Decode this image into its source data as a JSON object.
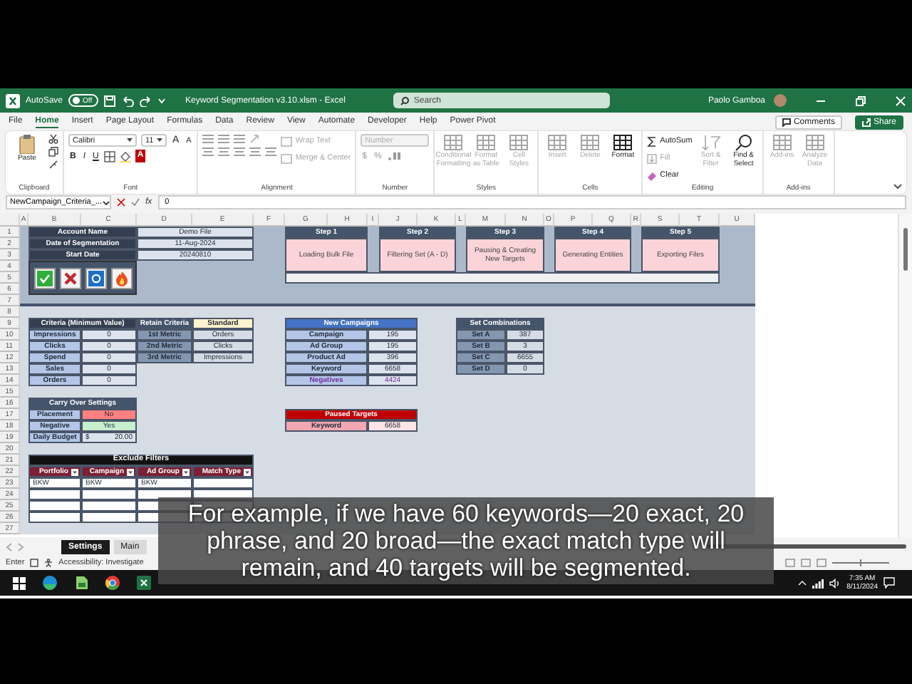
{
  "window": {
    "autosave_label": "AutoSave",
    "autosave_on": false,
    "autosave_state": "Off",
    "title": "Keyword Segmentation v3.10.xlsm - Excel",
    "search_placeholder": "Search",
    "user": "Paolo Gamboa"
  },
  "menu": [
    {
      "label": "File",
      "selected": false
    },
    {
      "label": "Home",
      "selected": true
    },
    {
      "label": "Insert",
      "selected": false
    },
    {
      "label": "Page Layout",
      "selected": false
    },
    {
      "label": "Formulas",
      "selected": false
    },
    {
      "label": "Data",
      "selected": false
    },
    {
      "label": "Review",
      "selected": false
    },
    {
      "label": "View",
      "selected": false
    },
    {
      "label": "Automate",
      "selected": false
    },
    {
      "label": "Developer",
      "selected": false
    },
    {
      "label": "Help",
      "selected": false
    },
    {
      "label": "Power Pivot",
      "selected": false
    }
  ],
  "header_buttons": [
    {
      "label": "Comments",
      "kind": "outline"
    },
    {
      "label": "Share",
      "kind": "primary"
    }
  ],
  "ribbon": [
    {
      "kind": "clipboard",
      "label": "Clipboard",
      "button": "Paste"
    },
    {
      "kind": "font",
      "label": "Font",
      "family": "Calibri",
      "size": "11",
      "size_buttons": [
        "A",
        "A"
      ],
      "style_buttons": [
        "B",
        "I",
        "U"
      ],
      "color_button": "A"
    },
    {
      "kind": "alignment",
      "label": "Alignment",
      "buttons": [
        {
          "label": "Wrap Text",
          "disabled": true
        },
        {
          "label": "Merge & Center",
          "disabled": true
        }
      ]
    },
    {
      "kind": "number",
      "label": "Number",
      "placeholder": "Number",
      "symbols": [
        "$",
        "%"
      ]
    },
    {
      "kind": "large",
      "label": "Styles",
      "buttons": [
        {
          "label": "Conditional Formatting",
          "disabled": true
        },
        {
          "label": "Format as Table",
          "disabled": true
        },
        {
          "label": "Cell Styles",
          "disabled": true
        }
      ]
    },
    {
      "kind": "large",
      "label": "Cells",
      "buttons": [
        {
          "label": "Insert",
          "disabled": true
        },
        {
          "label": "Delete",
          "disabled": true
        },
        {
          "label": "Format",
          "disabled": false
        }
      ]
    },
    {
      "kind": "editing",
      "label": "Editing",
      "small_buttons": [
        {
          "label": "AutoSum",
          "disabled": false
        },
        {
          "label": "Fill",
          "disabled": true
        },
        {
          "label": "Clear",
          "disabled": false
        }
      ],
      "buttons": [
        {
          "label": "Sort & Filter",
          "disabled": true
        },
        {
          "label": "Find & Select",
          "disabled": false
        }
      ]
    },
    {
      "kind": "large",
      "label": "Add-ins",
      "buttons": [
        {
          "label": "Add-ins",
          "disabled": true
        },
        {
          "label": "Analyze Data",
          "disabled": true
        }
      ]
    }
  ],
  "formula_bar": {
    "name_box": "NewCampaign_Criteria_...",
    "fx": "fx",
    "value": "0"
  },
  "columns": [
    "A",
    "B",
    "C",
    "D",
    "E",
    "F",
    "G",
    "H",
    "I",
    "J",
    "K",
    "L",
    "M",
    "N",
    "O",
    "P",
    "Q",
    "R",
    "S",
    "T",
    "U"
  ],
  "rows": [
    "1",
    "2",
    "3",
    "4",
    "5",
    "6",
    "7",
    "8",
    "9",
    "10",
    "11",
    "12",
    "13",
    "14",
    "15",
    "16",
    "17",
    "18",
    "19",
    "20",
    "21",
    "22",
    "23",
    "24",
    "25",
    "26",
    "27"
  ],
  "sheet": {
    "account": [
      {
        "label": "Account Name",
        "value": "Demo File"
      },
      {
        "label": "Date of Segmentation",
        "value": "11-Aug-2024"
      },
      {
        "label": "Start Date",
        "value": "20240810"
      }
    ],
    "steps": [
      {
        "label": "Step 1",
        "description": "Loading Bulk File"
      },
      {
        "label": "Step 2",
        "description": "Filtering Set (A - D)"
      },
      {
        "label": "Step 3",
        "description": "Pausing & Creating New Targets"
      },
      {
        "label": "Step 4",
        "description": "Generating Entities"
      },
      {
        "label": "Step 5",
        "description": "Exporting Files"
      }
    ],
    "criteria": {
      "title": "Criteria (Minimum Value)",
      "rows": [
        {
          "label": "Impressions",
          "value": "0"
        },
        {
          "label": "Clicks",
          "value": "0"
        },
        {
          "label": "Spend",
          "value": "0"
        },
        {
          "label": "Sales",
          "value": "0"
        },
        {
          "label": "Orders",
          "value": "0"
        }
      ]
    },
    "retain": {
      "title": "Retain Criteria",
      "mode": "Standard",
      "rows": [
        {
          "label": "1st Metric",
          "value": "Orders"
        },
        {
          "label": "2nd Metric",
          "value": "Clicks"
        },
        {
          "label": "3rd Metric",
          "value": "Impressions"
        }
      ]
    },
    "carry_over": {
      "title": "Carry Over Settings",
      "rows": [
        {
          "label": "Placement",
          "value": "No",
          "color": "#ff8080"
        },
        {
          "label": "Negative",
          "value": "Yes",
          "color": "#c6efce"
        }
      ],
      "budget": {
        "label": "Daily Budget",
        "currency": "$",
        "value": "20.00"
      }
    },
    "exclude_filters": {
      "title": "Exclude Filters",
      "columns": [
        "Portfolio",
        "Campaign",
        "Ad Group",
        "Match Type"
      ],
      "rows": [
        [
          "BKW",
          "BKW",
          "BKW"
        ]
      ]
    },
    "new_campaigns": {
      "title": "New Campaigns",
      "rows": [
        {
          "label": "Campaign",
          "value": "195",
          "emphasized": false
        },
        {
          "label": "Ad Group",
          "value": "195",
          "emphasized": false
        },
        {
          "label": "Product Ad",
          "value": "396",
          "emphasized": false
        },
        {
          "label": "Keyword",
          "value": "6658",
          "emphasized": false
        },
        {
          "label": "Negatives",
          "value": "4424",
          "emphasized": true
        }
      ]
    },
    "paused_targets": {
      "title": "Paused Targets",
      "rows": [
        {
          "label": "Keyword",
          "value": "6658"
        }
      ]
    },
    "set_combinations": {
      "title": "Set Combinations",
      "rows": [
        {
          "label": "Set A",
          "value": "387"
        },
        {
          "label": "Set B",
          "value": "3"
        },
        {
          "label": "Set C",
          "value": "6655"
        },
        {
          "label": "Set D",
          "value": "0"
        }
      ]
    }
  },
  "sheet_tabs": [
    {
      "label": "Settings",
      "selected": true
    },
    {
      "label": "Main",
      "selected": false
    }
  ],
  "status_bar": {
    "mode": "Enter",
    "accessibility": "Accessibility: Investigate"
  },
  "taskbar": {
    "time": "7:35 AM",
    "date": "8/11/2024"
  },
  "subtitle_lines": [
    "For example, if we have 60 keywords—20 exact, 20",
    "phrase, and 20 broad—the exact match type will",
    "remain, and 40 targets will be segmented."
  ]
}
